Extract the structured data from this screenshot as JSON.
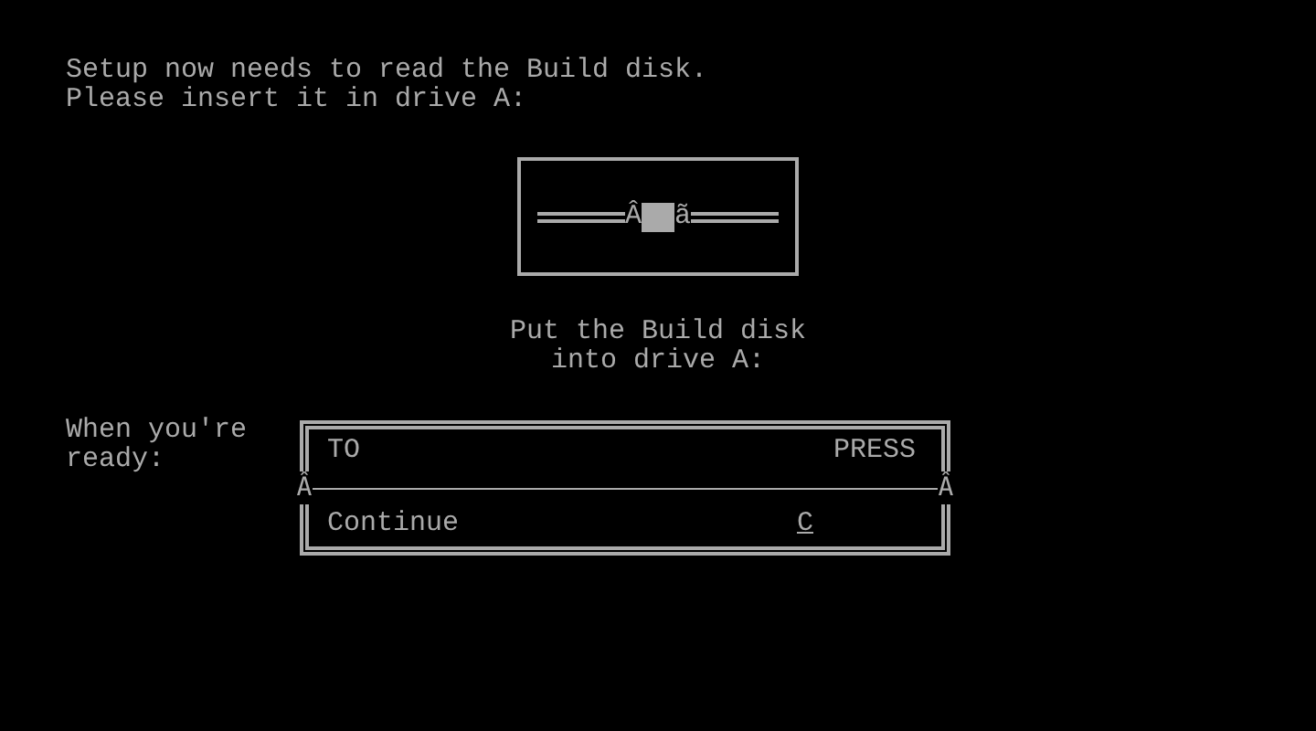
{
  "instructions": [
    "Setup now needs to read the Build disk.",
    "Please insert it in drive A:"
  ],
  "drive": {
    "left_glyph": "Â",
    "right_glyph": "ã"
  },
  "prompt": [
    "Put the Build disk",
    "into drive A:"
  ],
  "when_label": [
    "When you're",
    "ready:"
  ],
  "table": {
    "columns": [
      "TO",
      "PRESS"
    ],
    "divider_glyphs": [
      "Â",
      "Â"
    ],
    "rows": [
      {
        "action": "Continue",
        "key": "C"
      }
    ]
  }
}
